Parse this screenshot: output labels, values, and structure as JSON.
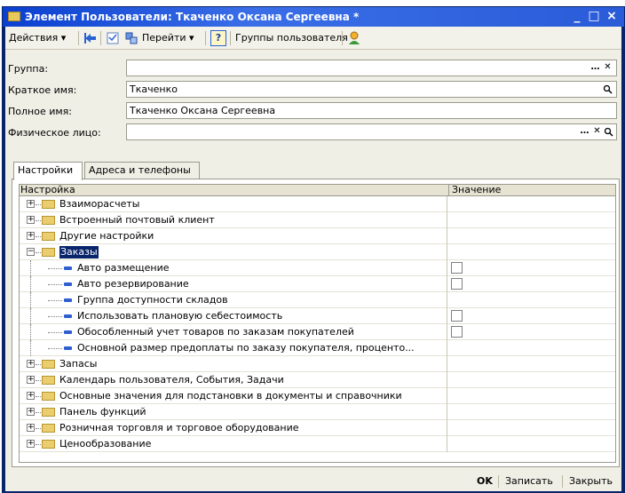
{
  "window": {
    "title": "Элемент Пользователи: Ткаченко Оксана Сергеевна *",
    "minimize": "_",
    "maximize": "□",
    "close": "×"
  },
  "toolbar": {
    "actions_label": "Действия",
    "goto_label": "Перейти",
    "help_label": "?",
    "user_groups_label": "Группы пользователя"
  },
  "form": {
    "group_label": "Группа:",
    "group_value": "",
    "short_name_label": "Краткое имя:",
    "short_name_value": "Ткаченко",
    "full_name_label": "Полное имя:",
    "full_name_value": "Ткаченко Оксана Сергеевна",
    "person_label": "Физическое лицо:",
    "person_value": ""
  },
  "tabs": [
    {
      "label": "Настройки",
      "active": true
    },
    {
      "label": "Адреса и телефоны",
      "active": false
    }
  ],
  "grid": {
    "col_setting": "Настройка",
    "col_value": "Значение",
    "rows": [
      {
        "label": "Взаиморасчеты",
        "type": "folder",
        "expanded": false
      },
      {
        "label": "Встроенный почтовый клиент",
        "type": "folder",
        "expanded": false
      },
      {
        "label": "Другие настройки",
        "type": "folder",
        "expanded": false
      },
      {
        "label": "Заказы",
        "type": "folder",
        "expanded": true,
        "selected": true
      },
      {
        "label": "Авто размещение",
        "type": "item",
        "checkbox": true
      },
      {
        "label": "Авто резервирование",
        "type": "item",
        "checkbox": true
      },
      {
        "label": "Группа доступности складов",
        "type": "item",
        "checkbox": false
      },
      {
        "label": "Использовать плановую себестоимость",
        "type": "item",
        "checkbox": true
      },
      {
        "label": "Обособленный учет товаров по заказам покупателей",
        "type": "item",
        "checkbox": true
      },
      {
        "label": "Основной размер предоплаты по заказу покупателя, проценто...",
        "type": "item",
        "checkbox": false
      },
      {
        "label": "Запасы",
        "type": "folder",
        "expanded": false
      },
      {
        "label": "Календарь пользователя, События, Задачи",
        "type": "folder",
        "expanded": false
      },
      {
        "label": "Основные значения для подстановки в документы и справочники",
        "type": "folder",
        "expanded": false
      },
      {
        "label": "Панель функций",
        "type": "folder",
        "expanded": false
      },
      {
        "label": "Розничная торговля и торговое оборудование",
        "type": "folder",
        "expanded": false
      },
      {
        "label": "Ценообразование",
        "type": "folder",
        "expanded": false
      }
    ]
  },
  "footer": {
    "ok_label": "OK",
    "save_label": "Записать",
    "close_label": "Закрыть"
  }
}
